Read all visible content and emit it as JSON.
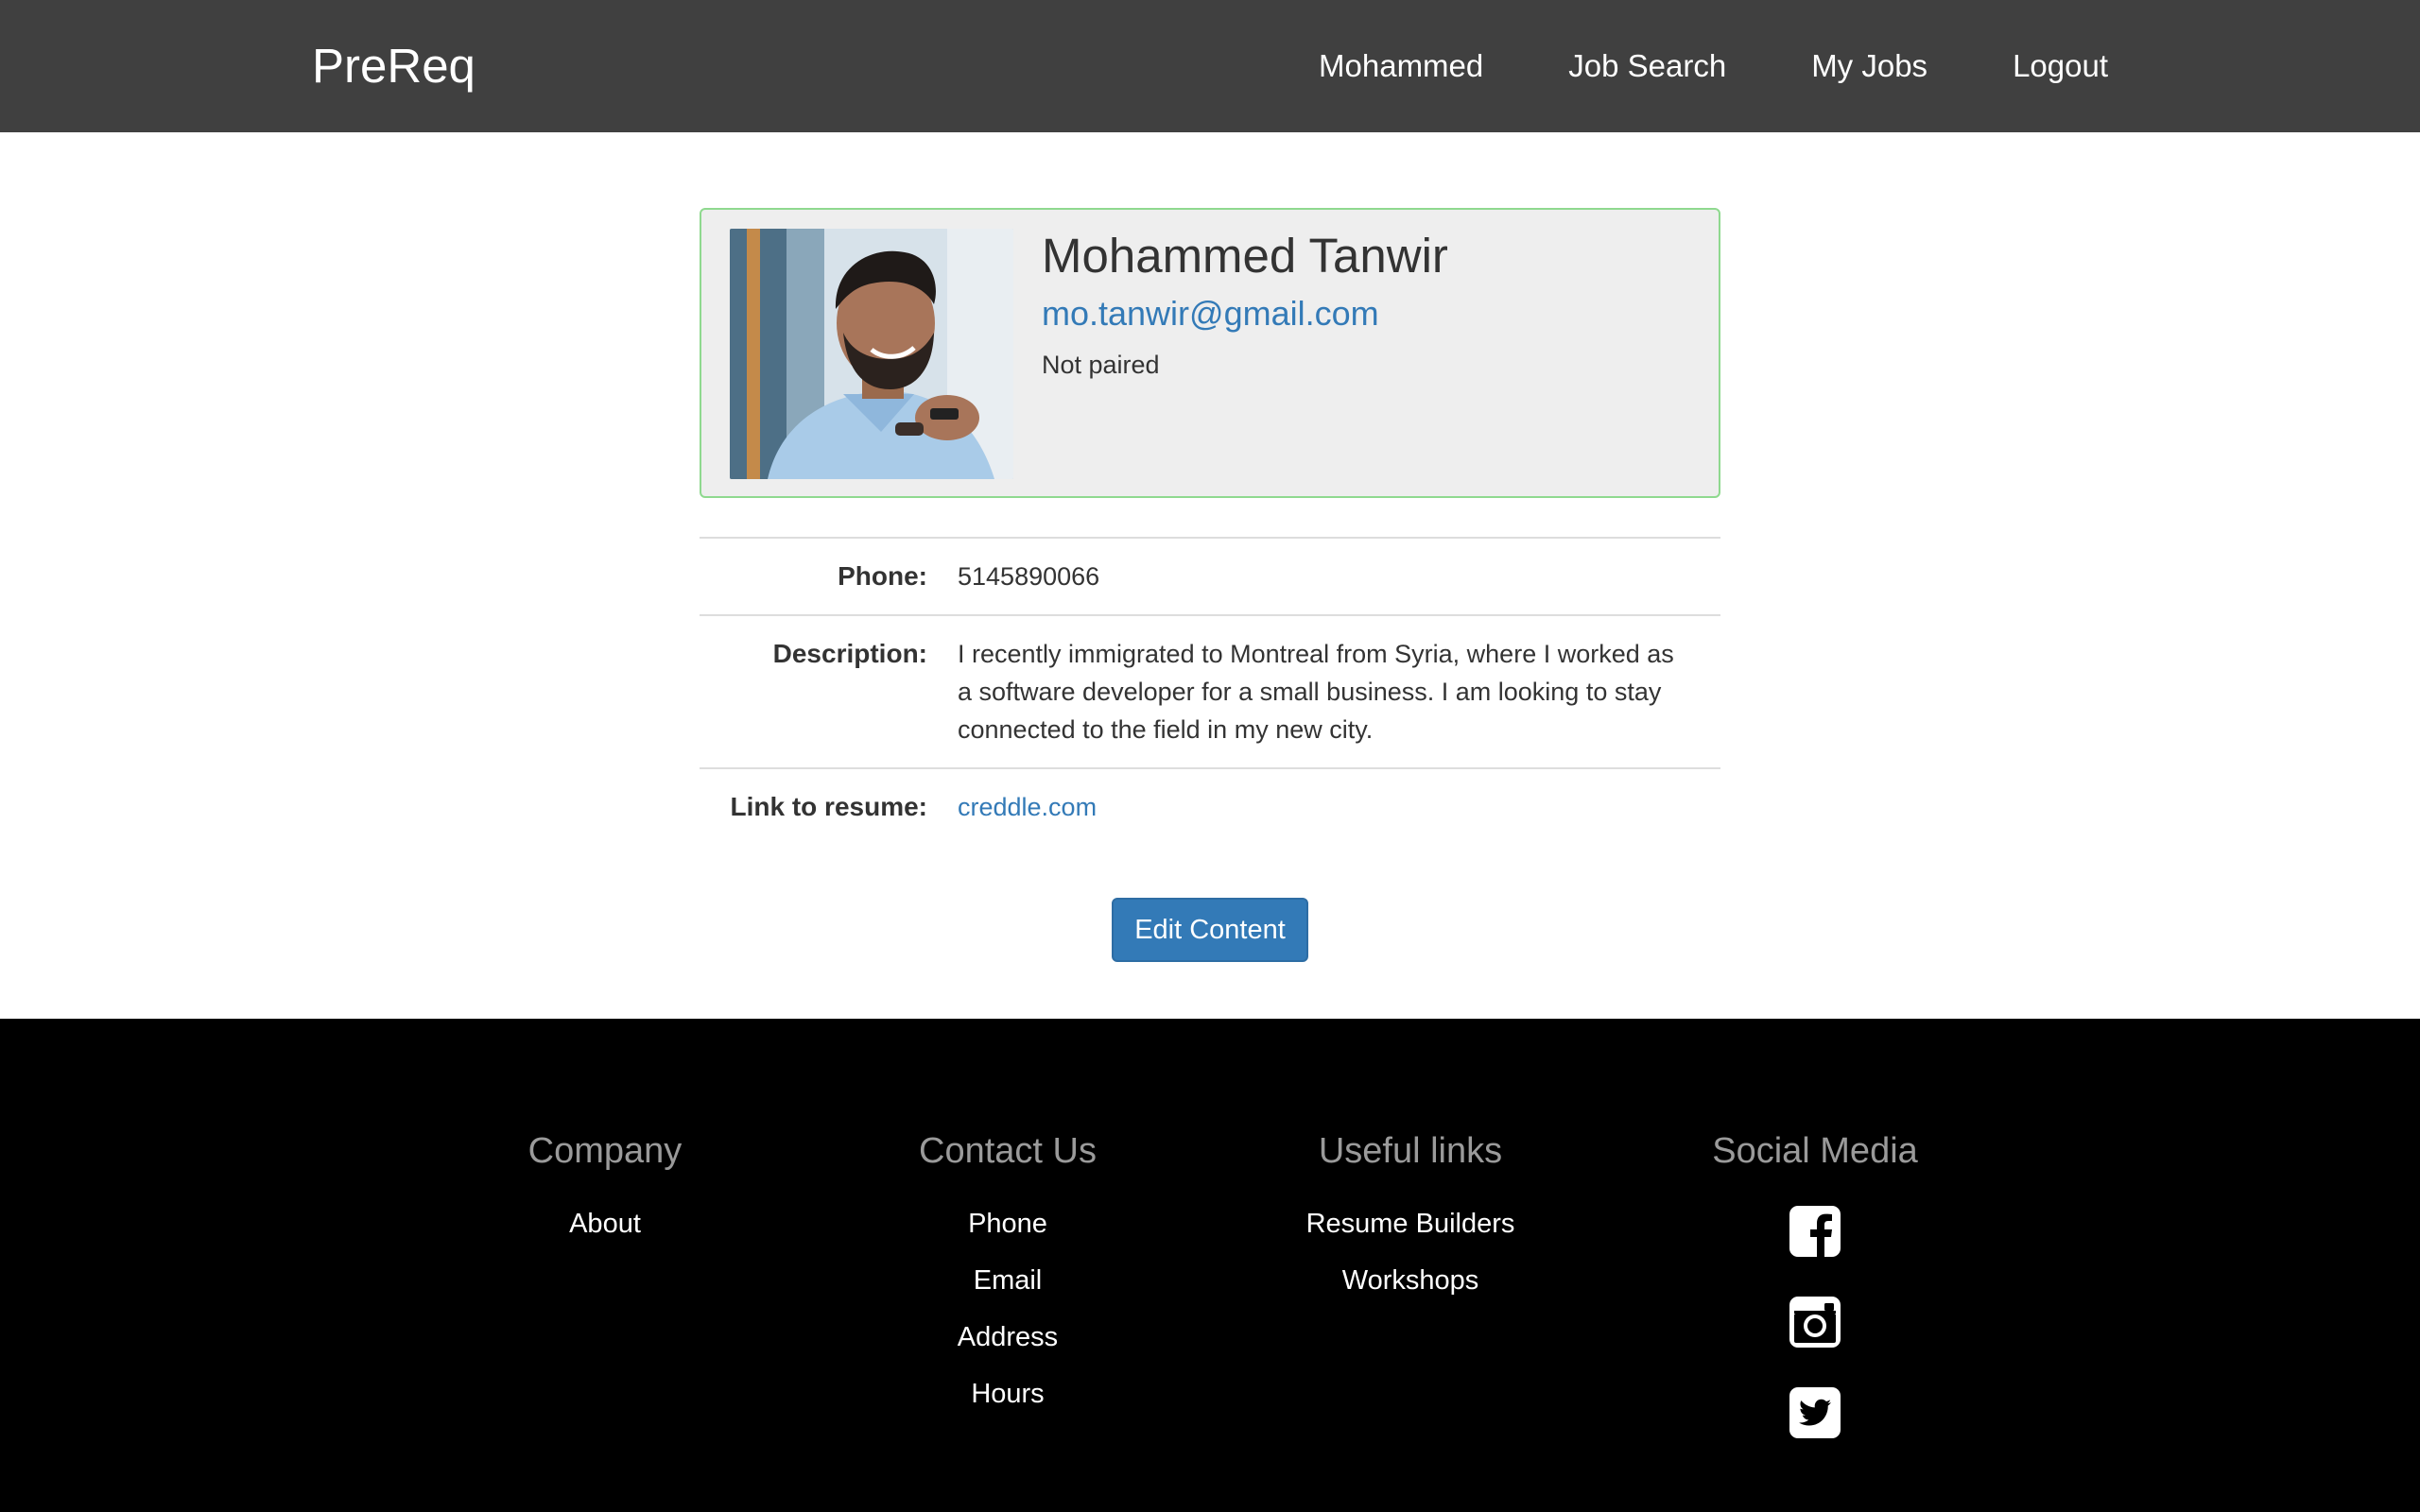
{
  "navbar": {
    "brand": "PreReq",
    "links": [
      {
        "label": "Mohammed"
      },
      {
        "label": "Job Search"
      },
      {
        "label": "My Jobs"
      },
      {
        "label": "Logout"
      }
    ]
  },
  "profile": {
    "name": "Mohammed Tanwir",
    "email": "mo.tanwir@gmail.com",
    "status": "Not paired",
    "photo_icon": "profile-photo"
  },
  "details": {
    "phone_label": "Phone:",
    "phone_value": "5145890066",
    "description_label": "Description:",
    "description_value": "I recently immigrated to Montreal from Syria, where I worked as a software developer for a small business. I am looking to stay connected to the field in my new city.",
    "resume_label": "Link to resume:",
    "resume_value": "creddle.com"
  },
  "actions": {
    "edit_label": "Edit Content"
  },
  "footer": {
    "company": {
      "heading": "Company",
      "links": [
        "About"
      ]
    },
    "contact": {
      "heading": "Contact Us",
      "links": [
        "Phone",
        "Email",
        "Address",
        "Hours"
      ]
    },
    "useful": {
      "heading": "Useful links",
      "links": [
        "Resume Builders",
        "Workshops"
      ]
    },
    "social": {
      "heading": "Social Media",
      "icons": [
        "facebook-icon",
        "instagram-icon",
        "twitter-icon"
      ]
    }
  },
  "colors": {
    "navbar_bg": "#404040",
    "link_blue": "#337ab7",
    "card_bg": "#eeeeee",
    "card_border": "#8fd98f",
    "footer_bg": "#000000",
    "footer_heading": "#9a9a9a"
  }
}
